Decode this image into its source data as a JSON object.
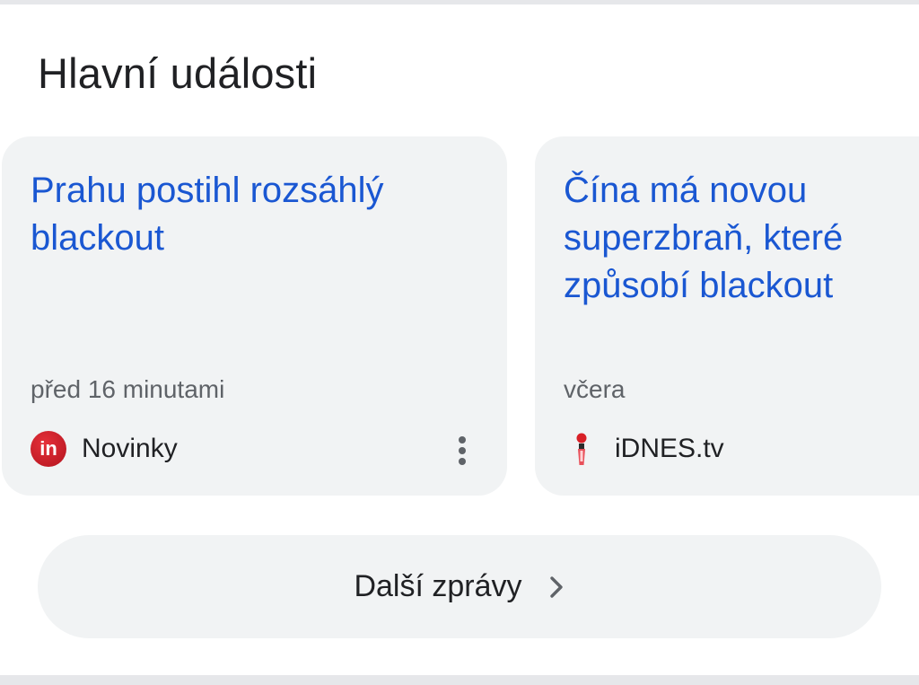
{
  "section": {
    "title": "Hlavní události"
  },
  "cards": [
    {
      "headline": "Prahu postihl rozsáhlý blackout",
      "time": "před 16 minutami",
      "source": "Novinky",
      "logo_text": "in",
      "logo_icon": "novinky-logo-icon",
      "menu_icon": "more-vert-icon"
    },
    {
      "headline": "Čína má novou superzbraň, které způsobí blackout",
      "time": "včera",
      "source": "iDNES.tv",
      "logo_icon": "idnes-logo-icon"
    }
  ],
  "more_button": {
    "label": "Další zprávy",
    "icon": "chevron-right-icon"
  },
  "colors": {
    "headline": "#1a57d2",
    "card_bg": "#f1f3f4",
    "muted_text": "#5f6368",
    "primary_text": "#202124",
    "novinky_brand": "#c8202a",
    "idnes_brand": "#d81f26"
  }
}
